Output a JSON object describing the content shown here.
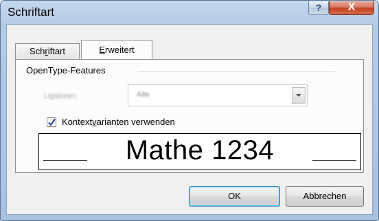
{
  "window": {
    "title": "Schriftart",
    "help_glyph": "?",
    "close_glyph": "X"
  },
  "tabs": [
    {
      "pre": "Sch",
      "mnemonic": "r",
      "post": "iftart",
      "active": false
    },
    {
      "pre": "",
      "mnemonic": "E",
      "post": "rweitert",
      "active": true
    }
  ],
  "opentype": {
    "group_label": "OpenType-Features",
    "ligatures_label": "Ligaturen:",
    "ligatures_value": "Alle",
    "context_checkbox": {
      "checked": true,
      "label_pre": "Kontext",
      "label_mnemonic": "v",
      "label_post": "arianten verwenden"
    }
  },
  "preview": {
    "text": "Mathe 1234"
  },
  "buttons": {
    "ok": "OK",
    "cancel": "Abbrechen"
  },
  "colors": {
    "titlebar": "#b4cbe6",
    "close_button": "#c23f22",
    "dialog_background": "#f0f0f0",
    "default_button_border": "#3c7fb1"
  }
}
